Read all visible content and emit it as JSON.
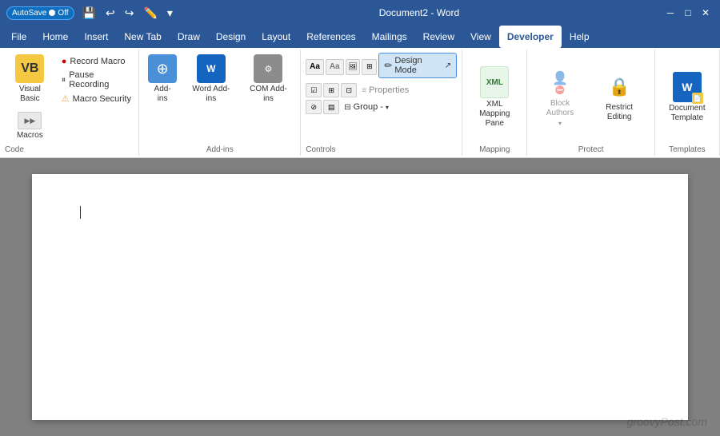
{
  "titleBar": {
    "autosave": "AutoSave",
    "autosaveState": "Off",
    "title": "Document2 - Word",
    "closeBtn": "✕",
    "minBtn": "─",
    "maxBtn": "□"
  },
  "menuBar": {
    "items": [
      "File",
      "Home",
      "Insert",
      "New Tab",
      "Draw",
      "Design",
      "Layout",
      "References",
      "Mailings",
      "Review",
      "View",
      "Developer",
      "Help"
    ],
    "activeItem": "Developer"
  },
  "ribbon": {
    "groups": {
      "code": {
        "label": "Code",
        "visualBasic": "Visual Basic",
        "macros": "Macros",
        "recordMacro": "Record Macro",
        "pauseRecording": "Pause Recording",
        "macroSecurity": "Macro Security"
      },
      "addins": {
        "label": "Add-ins",
        "addIns": "Add-ins",
        "wordAddIns": "Word Add-ins",
        "comAddIns": "COM Add-ins"
      },
      "controls": {
        "label": "Controls",
        "designMode": "Design Mode",
        "properties": "Properties",
        "group": "Group -"
      },
      "mapping": {
        "label": "Mapping",
        "xmlMappingPane": "XML Mapping Pane"
      },
      "protect": {
        "label": "Protect",
        "blockAuthors": "Block Authors",
        "restrictEditing": "Restrict Editing"
      },
      "templates": {
        "label": "Templates",
        "documentTemplate": "Document Template"
      }
    }
  },
  "document": {
    "watermark": "groovyPost.com"
  }
}
